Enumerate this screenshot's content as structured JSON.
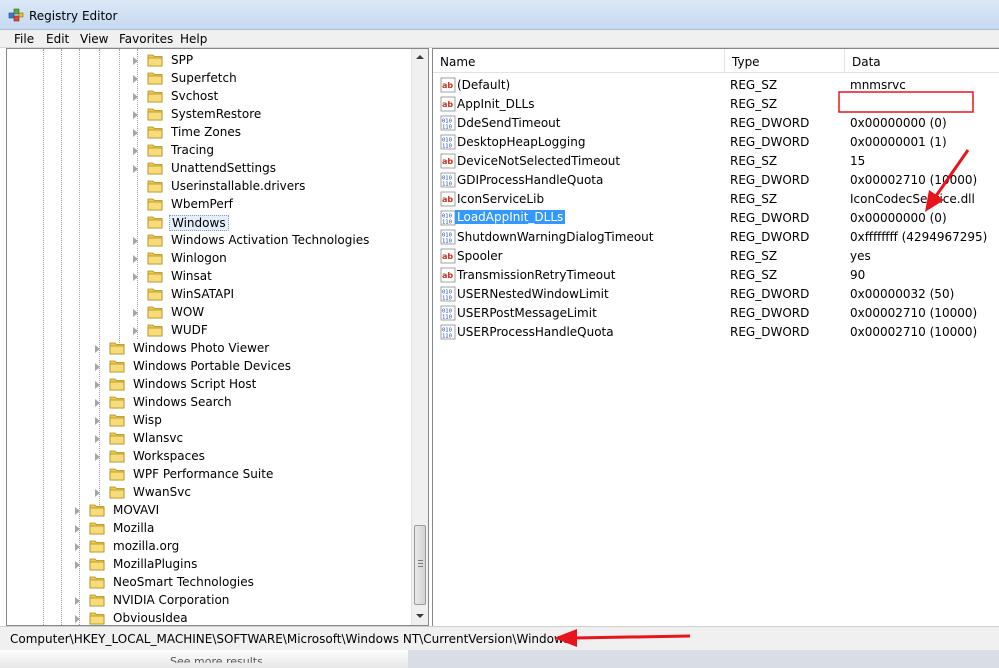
{
  "window": {
    "title": "Registry Editor",
    "icon": "registry-editor-icon"
  },
  "menu": {
    "items": [
      "File",
      "Edit",
      "View",
      "Favorites",
      "Help"
    ]
  },
  "tree": {
    "nodes": [
      {
        "label": "SPP",
        "depth": 3,
        "expandable": true
      },
      {
        "label": "Superfetch",
        "depth": 3,
        "expandable": true
      },
      {
        "label": "Svchost",
        "depth": 3,
        "expandable": true
      },
      {
        "label": "SystemRestore",
        "depth": 3,
        "expandable": true
      },
      {
        "label": "Time Zones",
        "depth": 3,
        "expandable": true
      },
      {
        "label": "Tracing",
        "depth": 3,
        "expandable": true
      },
      {
        "label": "UnattendSettings",
        "depth": 3,
        "expandable": true
      },
      {
        "label": "Userinstallable.drivers",
        "depth": 3,
        "expandable": false
      },
      {
        "label": "WbemPerf",
        "depth": 3,
        "expandable": false
      },
      {
        "label": "Windows",
        "depth": 3,
        "expandable": false,
        "selected": true
      },
      {
        "label": "Windows Activation Technologies",
        "depth": 3,
        "expandable": true
      },
      {
        "label": "Winlogon",
        "depth": 3,
        "expandable": true
      },
      {
        "label": "Winsat",
        "depth": 3,
        "expandable": true
      },
      {
        "label": "WinSATAPI",
        "depth": 3,
        "expandable": false
      },
      {
        "label": "WOW",
        "depth": 3,
        "expandable": true
      },
      {
        "label": "WUDF",
        "depth": 3,
        "expandable": true
      },
      {
        "label": "Windows Photo Viewer",
        "depth": 2,
        "expandable": true
      },
      {
        "label": "Windows Portable Devices",
        "depth": 2,
        "expandable": true
      },
      {
        "label": "Windows Script Host",
        "depth": 2,
        "expandable": true
      },
      {
        "label": "Windows Search",
        "depth": 2,
        "expandable": true
      },
      {
        "label": "Wisp",
        "depth": 2,
        "expandable": true
      },
      {
        "label": "Wlansvc",
        "depth": 2,
        "expandable": true
      },
      {
        "label": "Workspaces",
        "depth": 2,
        "expandable": true
      },
      {
        "label": "WPF Performance Suite",
        "depth": 2,
        "expandable": false
      },
      {
        "label": "WwanSvc",
        "depth": 2,
        "expandable": true
      },
      {
        "label": "MOVAVI",
        "depth": 1,
        "expandable": true
      },
      {
        "label": "Mozilla",
        "depth": 1,
        "expandable": true
      },
      {
        "label": "mozilla.org",
        "depth": 1,
        "expandable": true
      },
      {
        "label": "MozillaPlugins",
        "depth": 1,
        "expandable": true
      },
      {
        "label": "NeoSmart Technologies",
        "depth": 1,
        "expandable": false
      },
      {
        "label": "NVIDIA Corporation",
        "depth": 1,
        "expandable": true
      },
      {
        "label": "ObviousIdea",
        "depth": 1,
        "expandable": true
      }
    ]
  },
  "list": {
    "columns": [
      "Name",
      "Type",
      "Data"
    ],
    "rows": [
      {
        "icon": "string-value-icon",
        "name": "(Default)",
        "type": "REG_SZ",
        "data": "mnmsrvc"
      },
      {
        "icon": "string-value-icon",
        "name": "AppInit_DLLs",
        "type": "REG_SZ",
        "data": ""
      },
      {
        "icon": "binary-value-icon",
        "name": "DdeSendTimeout",
        "type": "REG_DWORD",
        "data": "0x00000000 (0)"
      },
      {
        "icon": "binary-value-icon",
        "name": "DesktopHeapLogging",
        "type": "REG_DWORD",
        "data": "0x00000001 (1)"
      },
      {
        "icon": "string-value-icon",
        "name": "DeviceNotSelectedTimeout",
        "type": "REG_SZ",
        "data": "15"
      },
      {
        "icon": "binary-value-icon",
        "name": "GDIProcessHandleQuota",
        "type": "REG_DWORD",
        "data": "0x00002710 (10000)"
      },
      {
        "icon": "string-value-icon",
        "name": "IconServiceLib",
        "type": "REG_SZ",
        "data": "IconCodecService.dll"
      },
      {
        "icon": "binary-value-icon",
        "name": "LoadAppInit_DLLs",
        "type": "REG_DWORD",
        "data": "0x00000000 (0)",
        "selected": true
      },
      {
        "icon": "binary-value-icon",
        "name": "ShutdownWarningDialogTimeout",
        "type": "REG_DWORD",
        "data": "0xffffffff (4294967295)"
      },
      {
        "icon": "string-value-icon",
        "name": "Spooler",
        "type": "REG_SZ",
        "data": "yes"
      },
      {
        "icon": "string-value-icon",
        "name": "TransmissionRetryTimeout",
        "type": "REG_SZ",
        "data": "90"
      },
      {
        "icon": "binary-value-icon",
        "name": "USERNestedWindowLimit",
        "type": "REG_DWORD",
        "data": "0x00000032 (50)"
      },
      {
        "icon": "binary-value-icon",
        "name": "USERPostMessageLimit",
        "type": "REG_DWORD",
        "data": "0x00002710 (10000)"
      },
      {
        "icon": "binary-value-icon",
        "name": "USERProcessHandleQuota",
        "type": "REG_DWORD",
        "data": "0x00002710 (10000)"
      }
    ]
  },
  "status": {
    "path": "Computer\\HKEY_LOCAL_MACHINE\\SOFTWARE\\Microsoft\\Windows NT\\CurrentVersion\\Windows"
  },
  "below_window": {
    "partial_text": "See more results"
  },
  "colors": {
    "selection": "#3399ff",
    "annotation_red": "#e8141b",
    "folder_yellow": "#f2c94c"
  }
}
